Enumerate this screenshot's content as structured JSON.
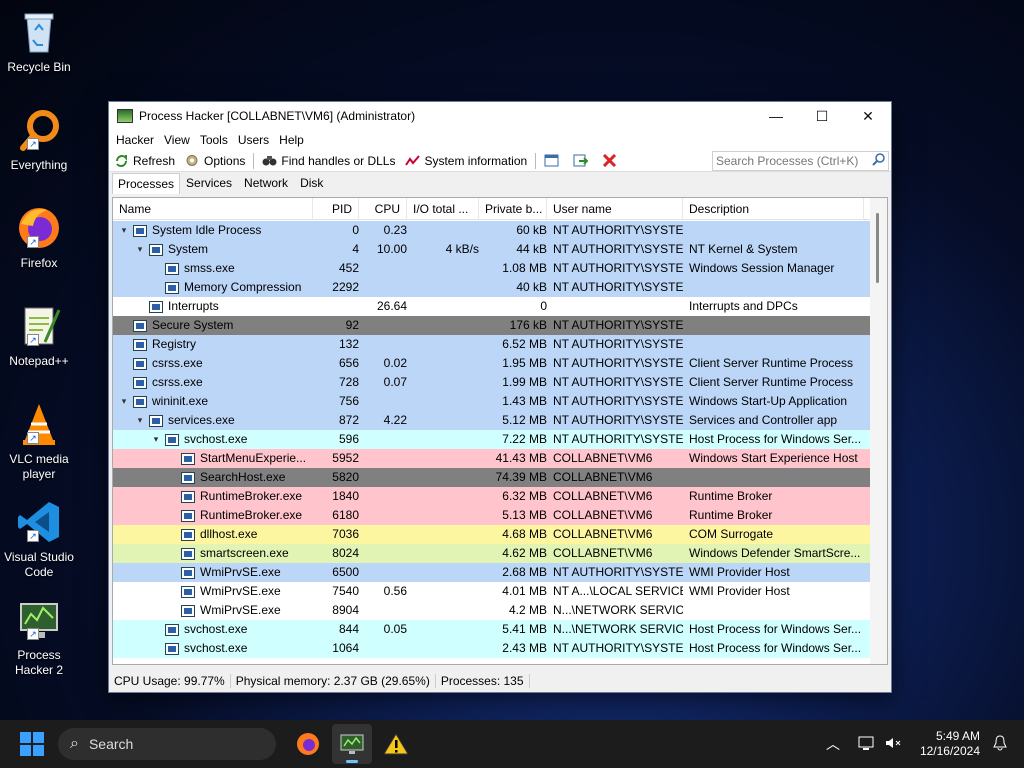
{
  "desktop": {
    "icons": [
      {
        "label": "Recycle Bin",
        "icon": "recycle-bin-icon"
      },
      {
        "label": "Everything",
        "icon": "everything-search-icon"
      },
      {
        "label": "Firefox",
        "icon": "firefox-icon"
      },
      {
        "label": "Notepad++",
        "icon": "notepadpp-icon"
      },
      {
        "label": "VLC media player",
        "icon": "vlc-icon"
      },
      {
        "label": "Visual Studio Code",
        "icon": "vscode-icon"
      },
      {
        "label": "Process Hacker 2",
        "icon": "process-hacker-icon"
      }
    ]
  },
  "window": {
    "title": "Process Hacker [COLLABNET\\VM6] (Administrator)",
    "menu": [
      "Hacker",
      "View",
      "Tools",
      "Users",
      "Help"
    ],
    "toolbar": {
      "refresh": "Refresh",
      "options": "Options",
      "find_handles": "Find handles or DLLs",
      "system_info": "System information"
    },
    "search_placeholder": "Search Processes (Ctrl+K)",
    "tabs": [
      "Processes",
      "Services",
      "Network",
      "Disk"
    ],
    "columns": [
      "Name",
      "PID",
      "CPU",
      "I/O total ...",
      "Private b...",
      "User name",
      "Description"
    ],
    "rows": [
      {
        "depth": 0,
        "exp": "v",
        "name": "System Idle Process",
        "pid": "0",
        "cpu": "0.23",
        "io": "",
        "priv": "60 kB",
        "user": "NT AUTHORITY\\SYSTEM",
        "desc": "",
        "bg": "#bcd6f7"
      },
      {
        "depth": 1,
        "exp": "v",
        "name": "System",
        "pid": "4",
        "cpu": "10.00",
        "io": "4 kB/s",
        "priv": "44 kB",
        "user": "NT AUTHORITY\\SYSTEM",
        "desc": "NT Kernel & System",
        "bg": "#bcd6f7"
      },
      {
        "depth": 2,
        "exp": "",
        "name": "smss.exe",
        "pid": "452",
        "cpu": "",
        "io": "",
        "priv": "1.08 MB",
        "user": "NT AUTHORITY\\SYSTEM",
        "desc": "Windows Session Manager",
        "bg": "#bcd6f7"
      },
      {
        "depth": 2,
        "exp": "",
        "name": "Memory Compression",
        "pid": "2292",
        "cpu": "",
        "io": "",
        "priv": "40 kB",
        "user": "NT AUTHORITY\\SYSTEM",
        "desc": "",
        "bg": "#bcd6f7"
      },
      {
        "depth": 1,
        "exp": "",
        "name": "Interrupts",
        "pid": "",
        "cpu": "26.64",
        "io": "",
        "priv": "0",
        "user": "",
        "desc": "Interrupts and DPCs",
        "bg": "#ffffff"
      },
      {
        "depth": 0,
        "exp": "",
        "name": "Secure System",
        "pid": "92",
        "cpu": "",
        "io": "",
        "priv": "176 kB",
        "user": "NT AUTHORITY\\SYSTEM",
        "desc": "",
        "bg": "#808080"
      },
      {
        "depth": 0,
        "exp": "",
        "name": "Registry",
        "pid": "132",
        "cpu": "",
        "io": "",
        "priv": "6.52 MB",
        "user": "NT AUTHORITY\\SYSTEM",
        "desc": "",
        "bg": "#bcd6f7"
      },
      {
        "depth": 0,
        "exp": "",
        "name": "csrss.exe",
        "pid": "656",
        "cpu": "0.02",
        "io": "",
        "priv": "1.95 MB",
        "user": "NT AUTHORITY\\SYSTEM",
        "desc": "Client Server Runtime Process",
        "bg": "#bcd6f7"
      },
      {
        "depth": 0,
        "exp": "",
        "name": "csrss.exe",
        "pid": "728",
        "cpu": "0.07",
        "io": "",
        "priv": "1.99 MB",
        "user": "NT AUTHORITY\\SYSTEM",
        "desc": "Client Server Runtime Process",
        "bg": "#bcd6f7"
      },
      {
        "depth": 0,
        "exp": "v",
        "name": "wininit.exe",
        "pid": "756",
        "cpu": "",
        "io": "",
        "priv": "1.43 MB",
        "user": "NT AUTHORITY\\SYSTEM",
        "desc": "Windows Start-Up Application",
        "bg": "#bcd6f7"
      },
      {
        "depth": 1,
        "exp": "v",
        "name": "services.exe",
        "pid": "872",
        "cpu": "4.22",
        "io": "",
        "priv": "5.12 MB",
        "user": "NT AUTHORITY\\SYSTEM",
        "desc": "Services and Controller app",
        "bg": "#bcd6f7"
      },
      {
        "depth": 2,
        "exp": "v",
        "name": "svchost.exe",
        "pid": "596",
        "cpu": "",
        "io": "",
        "priv": "7.22 MB",
        "user": "NT AUTHORITY\\SYSTEM",
        "desc": "Host Process for Windows Ser...",
        "bg": "#d0ffff"
      },
      {
        "depth": 3,
        "exp": "",
        "name": "StartMenuExperie...",
        "pid": "5952",
        "cpu": "",
        "io": "",
        "priv": "41.43 MB",
        "user": "COLLABNET\\VM6",
        "desc": "Windows Start Experience Host",
        "bg": "#ffc4cc"
      },
      {
        "depth": 3,
        "exp": "",
        "name": "SearchHost.exe",
        "pid": "5820",
        "cpu": "",
        "io": "",
        "priv": "74.39 MB",
        "user": "COLLABNET\\VM6",
        "desc": "",
        "bg": "#808080"
      },
      {
        "depth": 3,
        "exp": "",
        "name": "RuntimeBroker.exe",
        "pid": "1840",
        "cpu": "",
        "io": "",
        "priv": "6.32 MB",
        "user": "COLLABNET\\VM6",
        "desc": "Runtime Broker",
        "bg": "#ffc4cc"
      },
      {
        "depth": 3,
        "exp": "",
        "name": "RuntimeBroker.exe",
        "pid": "6180",
        "cpu": "",
        "io": "",
        "priv": "5.13 MB",
        "user": "COLLABNET\\VM6",
        "desc": "Runtime Broker",
        "bg": "#ffc4cc"
      },
      {
        "depth": 3,
        "exp": "",
        "name": "dllhost.exe",
        "pid": "7036",
        "cpu": "",
        "io": "",
        "priv": "4.68 MB",
        "user": "COLLABNET\\VM6",
        "desc": "COM Surrogate",
        "bg": "#fdf6a0"
      },
      {
        "depth": 3,
        "exp": "",
        "name": "smartscreen.exe",
        "pid": "8024",
        "cpu": "",
        "io": "",
        "priv": "4.62 MB",
        "user": "COLLABNET\\VM6",
        "desc": "Windows Defender SmartScre...",
        "bg": "#e2f4b4"
      },
      {
        "depth": 3,
        "exp": "",
        "name": "WmiPrvSE.exe",
        "pid": "6500",
        "cpu": "",
        "io": "",
        "priv": "2.68 MB",
        "user": "NT AUTHORITY\\SYSTEM",
        "desc": "WMI Provider Host",
        "bg": "#bcd6f7"
      },
      {
        "depth": 3,
        "exp": "",
        "name": "WmiPrvSE.exe",
        "pid": "7540",
        "cpu": "0.56",
        "io": "",
        "priv": "4.01 MB",
        "user": "NT A...\\LOCAL SERVICE",
        "desc": "WMI Provider Host",
        "bg": "#ffffff"
      },
      {
        "depth": 3,
        "exp": "",
        "name": "WmiPrvSE.exe",
        "pid": "8904",
        "cpu": "",
        "io": "",
        "priv": "4.2 MB",
        "user": "N...\\NETWORK SERVICE",
        "desc": "",
        "bg": "#ffffff"
      },
      {
        "depth": 2,
        "exp": "",
        "name": "svchost.exe",
        "pid": "844",
        "cpu": "0.05",
        "io": "",
        "priv": "5.41 MB",
        "user": "N...\\NETWORK SERVICE",
        "desc": "Host Process for Windows Ser...",
        "bg": "#d0ffff"
      },
      {
        "depth": 2,
        "exp": "",
        "name": "svchost.exe",
        "pid": "1064",
        "cpu": "",
        "io": "",
        "priv": "2.43 MB",
        "user": "NT AUTHORITY\\SYSTEM",
        "desc": "Host Process for Windows Ser...",
        "bg": "#d0ffff"
      }
    ],
    "status": {
      "cpu_usage": "CPU Usage: 99.77%",
      "physical_memory": "Physical memory: 2.37 GB (29.65%)",
      "processes": "Processes: 135"
    }
  },
  "taskbar": {
    "search_label": "Search",
    "time": "5:49 AM",
    "date": "12/16/2024"
  }
}
